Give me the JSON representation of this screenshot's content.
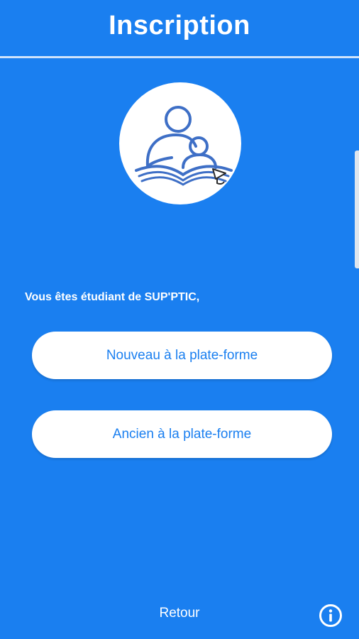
{
  "header": {
    "title": "Inscription"
  },
  "logo": {
    "icon": "reading-students-logo-icon",
    "color": "#3e6fc6"
  },
  "prompt": {
    "text": "Vous êtes étudiant de SUP'PTIC,"
  },
  "buttons": {
    "new_label": "Nouveau à la plate-forme",
    "old_label": "Ancien à la plate-forme"
  },
  "footer": {
    "back_label": "Retour",
    "info_icon": "info-icon"
  },
  "colors": {
    "background": "#1a7ff0",
    "button_bg": "#ffffff",
    "button_text": "#1a7ff0"
  }
}
